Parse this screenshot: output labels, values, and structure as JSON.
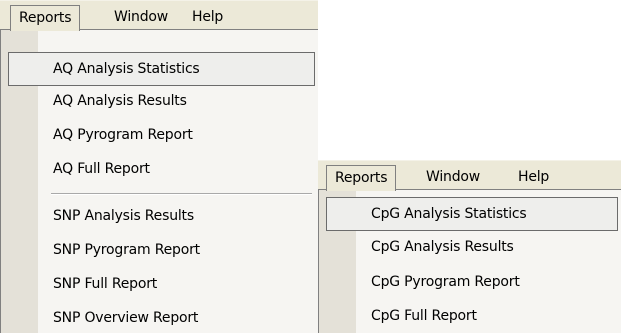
{
  "aq_panel": {
    "menubar": [
      "Reports",
      "Window",
      "Help"
    ],
    "items": [
      "AQ Analysis Statistics",
      "AQ Analysis Results",
      "AQ Pyrogram Report",
      "AQ Full Report",
      "SNP Analysis Results",
      "SNP Pyrogram Report",
      "SNP Full Report",
      "SNP Overview Report"
    ],
    "highlighted": "AQ Analysis Statistics"
  },
  "cpg_panel": {
    "menubar": [
      "Reports",
      "Window",
      "Help"
    ],
    "items": [
      "CpG Analysis Statistics",
      "CpG Analysis Results",
      "CpG Pyrogram Report",
      "CpG Full Report"
    ],
    "highlighted": "CpG Analysis Statistics"
  }
}
